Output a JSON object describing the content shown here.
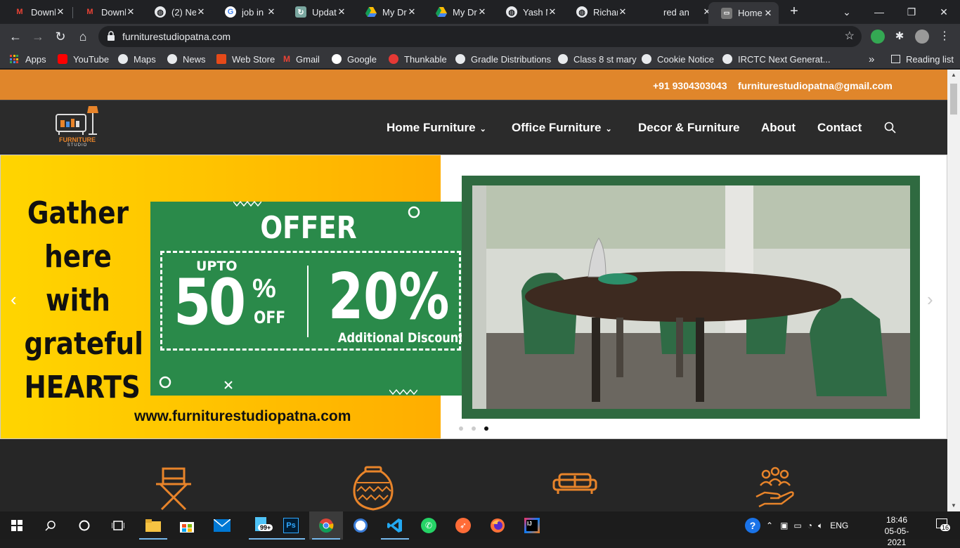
{
  "browser": {
    "tabs": [
      {
        "title": "Downl",
        "icon": "gmail-icon"
      },
      {
        "title": "Downl",
        "icon": "gmail-icon"
      },
      {
        "title": "(2) Ne",
        "icon": "globe-icon"
      },
      {
        "title": "job in",
        "icon": "google-icon"
      },
      {
        "title": "Updat",
        "icon": "page-icon"
      },
      {
        "title": "My Dri",
        "icon": "drive-icon"
      },
      {
        "title": "My Dri",
        "icon": "drive-icon"
      },
      {
        "title": "Yash M",
        "icon": "globe-icon"
      },
      {
        "title": "Richar",
        "icon": "globe-icon"
      },
      {
        "title": "red an",
        "icon": "none"
      },
      {
        "title": "Home",
        "icon": "site-icon",
        "active": true
      }
    ],
    "url": "furniturestudiopatna.com",
    "bookmarks": [
      {
        "label": "Apps"
      },
      {
        "label": "YouTube"
      },
      {
        "label": "Maps"
      },
      {
        "label": "News"
      },
      {
        "label": "Web Store"
      },
      {
        "label": "Gmail"
      },
      {
        "label": "Google"
      },
      {
        "label": "Thunkable"
      },
      {
        "label": "Gradle Distributions"
      },
      {
        "label": "Class 8 st mary"
      },
      {
        "label": "Cookie Notice"
      },
      {
        "label": "IRCTC Next Generat..."
      }
    ],
    "more_bookmarks": "»",
    "reading_list": "Reading list"
  },
  "site": {
    "phone": "+91 9304303043",
    "email": "furniturestudiopatna@gmail.com",
    "logo_text_1": "FURNITURE",
    "logo_text_2": "STUDIO",
    "nav": [
      {
        "label": "Home Furniture",
        "dropdown": true
      },
      {
        "label": "Office Furniture",
        "dropdown": true
      },
      {
        "label": "Decor & Furniture",
        "dropdown": false
      },
      {
        "label": "About",
        "dropdown": false
      },
      {
        "label": "Contact",
        "dropdown": false
      }
    ],
    "slide": {
      "headline_lines": [
        "Gather",
        "here",
        "with",
        "grateful",
        "HEARTS"
      ],
      "offer": "OFFER",
      "upto": "UPTO",
      "big_percent": "50",
      "pct_sign": "%",
      "off": "OFF",
      "extra_percent": "20%",
      "extra_label": "Additional Discount",
      "website": "www.furniturestudiopatna.com",
      "prev": "‹",
      "next": "›",
      "active_dot": 2
    }
  },
  "taskbar": {
    "language": "ENG",
    "time": "18:46",
    "date": "05-05-2021",
    "notif_count": "16",
    "badge_99": "99+"
  },
  "colors": {
    "topbar": "#e0862b",
    "accent_orange": "#e8842a",
    "green_panel": "#2a8a4a"
  }
}
